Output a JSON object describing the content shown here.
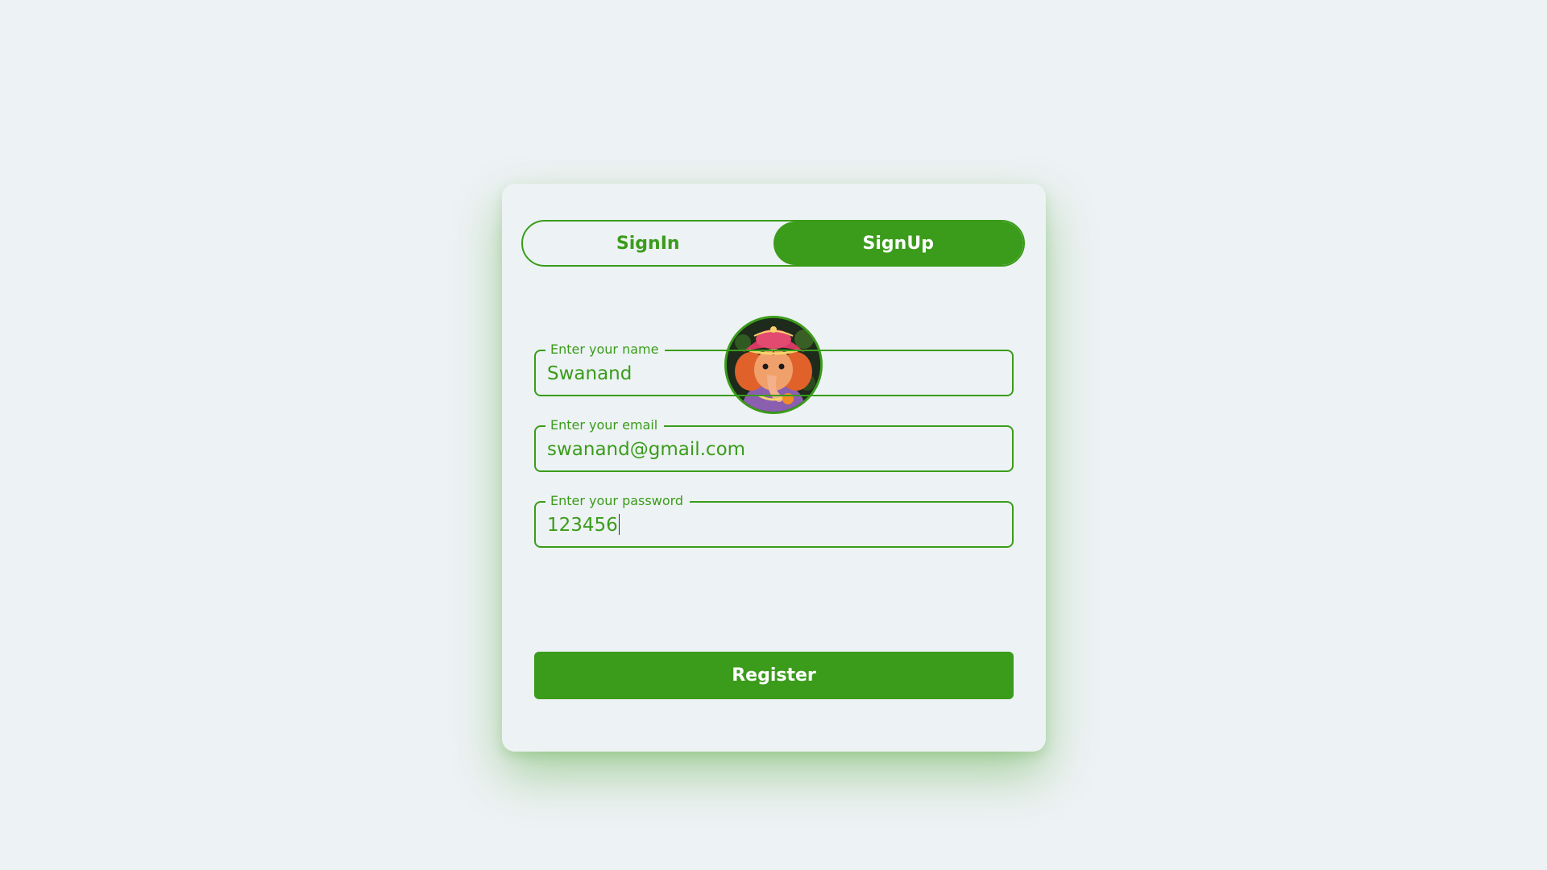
{
  "colors": {
    "accent": "#3a9c1a",
    "background": "#edf2f4",
    "button_text": "#ffffff"
  },
  "auth_toggle": {
    "signin_label": "SignIn",
    "signup_label": "SignUp",
    "active_tab": "SignUp"
  },
  "avatar": {
    "icon": "ganesha-avatar"
  },
  "form": {
    "name": {
      "label": "Enter your name",
      "value": "Swanand"
    },
    "email": {
      "label": "Enter your email",
      "value": "swanand@gmail.com"
    },
    "password": {
      "label": "Enter your password",
      "value": "123456"
    },
    "submit_label": "Register"
  }
}
